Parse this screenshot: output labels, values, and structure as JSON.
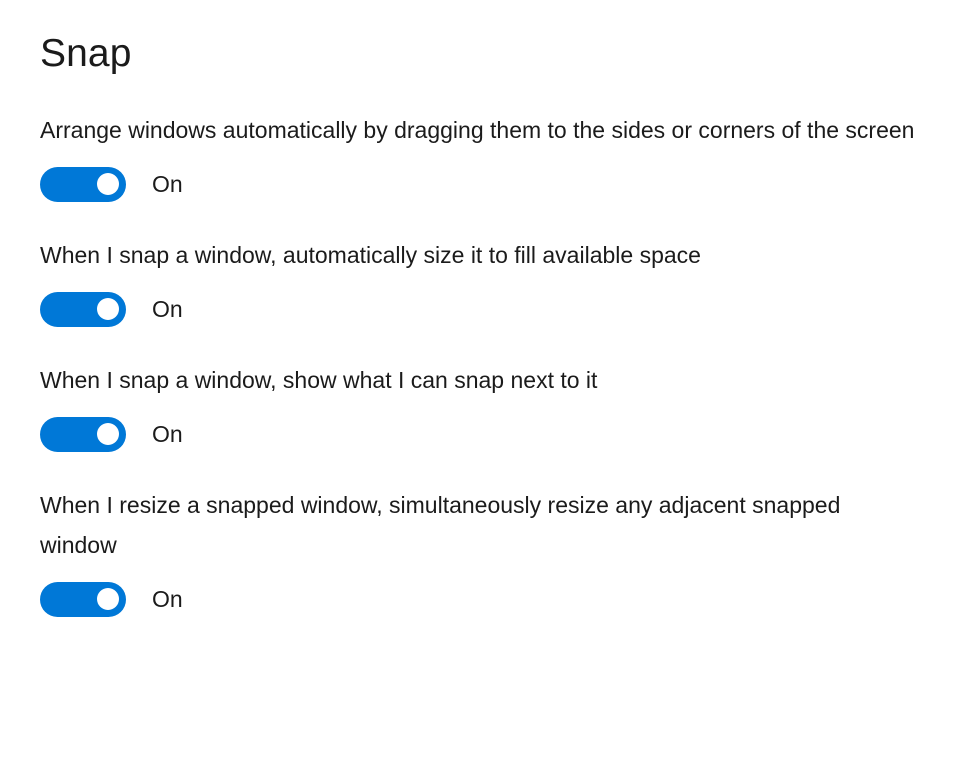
{
  "page": {
    "title": "Snap"
  },
  "settings": [
    {
      "id": "arrange-windows-automatically",
      "description": "Arrange windows automatically by dragging them to the sides or corners of the screen",
      "toggle": {
        "state": "on",
        "state_label": "On"
      }
    },
    {
      "id": "auto-size-to-fill-available-space",
      "description": "When I snap a window, automatically size it to fill available space",
      "toggle": {
        "state": "on",
        "state_label": "On"
      }
    },
    {
      "id": "show-what-i-can-snap-next-to",
      "description": "When I snap a window, show what I can snap next to it",
      "toggle": {
        "state": "on",
        "state_label": "On"
      }
    },
    {
      "id": "resize-adjacent-snapped-window",
      "description": "When I resize a snapped window, simultaneously resize any adjacent snapped window",
      "toggle": {
        "state": "on",
        "state_label": "On"
      }
    }
  ],
  "colors": {
    "accent": "#0078d7",
    "background": "#ffffff",
    "text": "#1b1b1b",
    "knob": "#ffffff"
  }
}
